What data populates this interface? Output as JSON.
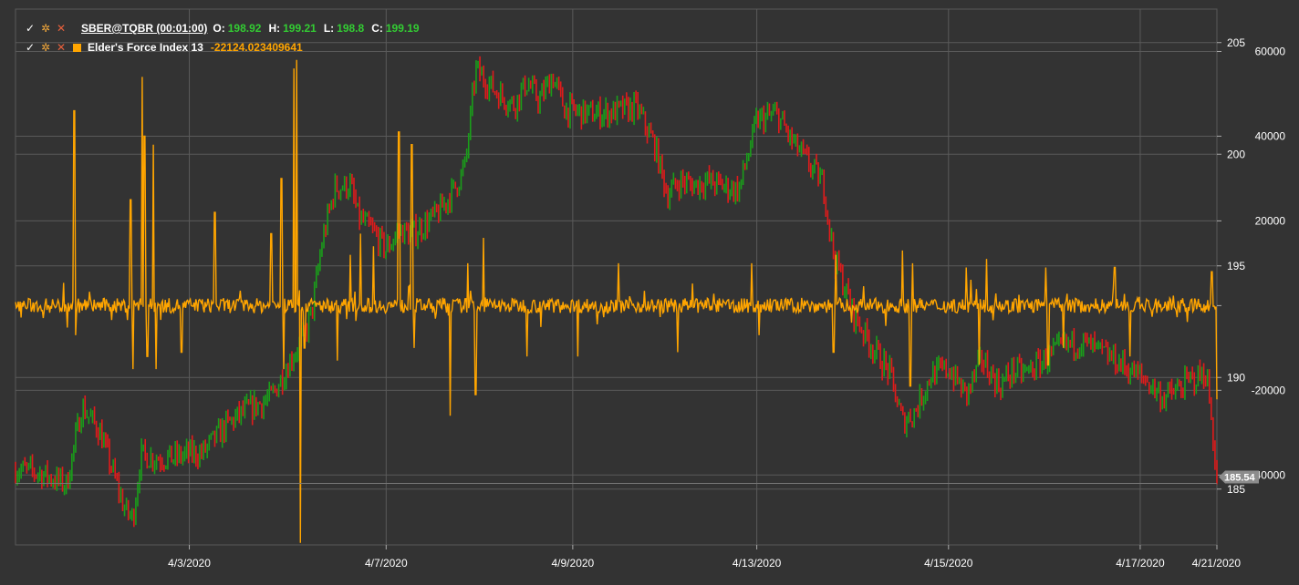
{
  "legend": {
    "symbol": "SBER@TQBR (00:01:00)",
    "o_label": "O:",
    "o": "198.92",
    "h_label": "H:",
    "h": "199.21",
    "l_label": "L:",
    "l": "198.8",
    "c_label": "C:",
    "c": "199.19",
    "indicator_name": "Elder's Force Index 13",
    "indicator_value": "-22124.023409641"
  },
  "icons": [
    "check-icon",
    "gear-icon",
    "close-icon",
    "color-square-icon"
  ],
  "colors": {
    "background": "#333333",
    "grid": "#5a5a5a",
    "up": "#1a9e1a",
    "down": "#e01b1b",
    "indicator": "#ffa500",
    "price_badge": "#8c8c8c"
  },
  "chart_data": {
    "type": "candlestick",
    "x_ticks": [
      "4/3/2020",
      "4/7/2020",
      "4/9/2020",
      "4/13/2020",
      "4/15/2020",
      "4/17/2020",
      "4/21/2020"
    ],
    "price_axis": {
      "ticks": [
        "205",
        "200",
        "195",
        "190",
        "185"
      ],
      "range": [
        182.5,
        206.5
      ]
    },
    "indicator_axis": {
      "ticks": [
        "60000",
        "40000",
        "20000",
        "",
        "-20000",
        "-40000"
      ],
      "range": [
        -56500,
        70000
      ]
    },
    "last_price": "185.54",
    "price_path": [
      [
        0.0,
        185.9
      ],
      [
        1.0,
        185.7
      ],
      [
        2.0,
        185.2
      ],
      [
        2.6,
        188.7
      ],
      [
        2.9,
        188.2
      ],
      [
        3.3,
        187.6
      ],
      [
        4.3,
        184.0
      ],
      [
        4.6,
        183.7
      ],
      [
        4.9,
        186.5
      ],
      [
        5.5,
        186.4
      ],
      [
        6.2,
        186.4
      ],
      [
        6.9,
        186.6
      ],
      [
        7.3,
        186.6
      ],
      [
        8.3,
        187.9
      ],
      [
        9.0,
        188.5
      ],
      [
        10.0,
        189.1
      ],
      [
        10.5,
        190.2
      ],
      [
        10.8,
        190.9
      ],
      [
        11.3,
        191.8
      ],
      [
        11.6,
        193.0
      ],
      [
        12.0,
        196.1
      ],
      [
        12.5,
        198.5
      ],
      [
        13.1,
        198.6
      ],
      [
        13.4,
        197.2
      ],
      [
        14.0,
        196.5
      ],
      [
        14.5,
        195.7
      ],
      [
        15.0,
        196.6
      ],
      [
        15.5,
        196.4
      ],
      [
        16.5,
        197.3
      ],
      [
        17.2,
        198.5
      ],
      [
        17.6,
        199.5
      ],
      [
        18.0,
        203.8
      ],
      [
        18.8,
        202.8
      ],
      [
        19.5,
        202.2
      ],
      [
        20.0,
        203.2
      ],
      [
        20.5,
        202.4
      ],
      [
        21.0,
        203.5
      ],
      [
        21.5,
        202.0
      ],
      [
        22.5,
        201.8
      ],
      [
        23.5,
        201.9
      ],
      [
        24.3,
        202.1
      ],
      [
        25.0,
        200.4
      ],
      [
        25.5,
        198.2
      ],
      [
        26.0,
        198.8
      ],
      [
        26.5,
        198.6
      ],
      [
        27.0,
        198.8
      ],
      [
        27.9,
        198.5
      ],
      [
        28.3,
        198.4
      ],
      [
        29.0,
        201.5
      ],
      [
        29.8,
        201.8
      ],
      [
        30.3,
        200.7
      ],
      [
        31.0,
        199.6
      ],
      [
        31.6,
        198.7
      ],
      [
        32.0,
        195.5
      ],
      [
        32.8,
        192.8
      ],
      [
        33.5,
        191.4
      ],
      [
        34.2,
        190.2
      ],
      [
        34.7,
        188.0
      ],
      [
        35.2,
        188.5
      ],
      [
        35.8,
        190.1
      ],
      [
        36.5,
        190.4
      ],
      [
        37.2,
        189.2
      ],
      [
        37.8,
        190.8
      ],
      [
        38.5,
        189.6
      ],
      [
        39.0,
        190.3
      ],
      [
        39.5,
        190.2
      ],
      [
        40.3,
        190.8
      ],
      [
        41.0,
        191.4
      ],
      [
        41.7,
        191.6
      ],
      [
        42.3,
        191.2
      ],
      [
        43.0,
        190.8
      ],
      [
        43.5,
        190.4
      ],
      [
        44.2,
        189.9
      ],
      [
        44.9,
        189.1
      ],
      [
        45.3,
        189.3
      ],
      [
        46.0,
        189.9
      ],
      [
        46.6,
        190.2
      ],
      [
        47.0,
        185.5
      ]
    ],
    "indicator_spikes": [
      [
        2.3,
        46000
      ],
      [
        2.35,
        -7000
      ],
      [
        4.5,
        25000
      ],
      [
        4.6,
        -15000
      ],
      [
        4.95,
        54000
      ],
      [
        5.05,
        40000
      ],
      [
        5.15,
        -12000
      ],
      [
        5.4,
        38000
      ],
      [
        5.5,
        -15000
      ],
      [
        6.5,
        -11000
      ],
      [
        7.8,
        22000
      ],
      [
        10.0,
        17000
      ],
      [
        10.4,
        30000
      ],
      [
        10.5,
        -15000
      ],
      [
        10.9,
        56000
      ],
      [
        11.0,
        58000
      ],
      [
        11.15,
        -56000
      ],
      [
        11.3,
        -10000
      ],
      [
        12.6,
        -13000
      ],
      [
        13.1,
        12000
      ],
      [
        13.5,
        17000
      ],
      [
        14.0,
        14000
      ],
      [
        15.0,
        41000
      ],
      [
        15.5,
        38000
      ],
      [
        15.6,
        -10000
      ],
      [
        17.0,
        -26000
      ],
      [
        17.7,
        10000
      ],
      [
        18.0,
        -21000
      ],
      [
        18.3,
        16000
      ],
      [
        20.0,
        -12000
      ],
      [
        22.0,
        -12000
      ],
      [
        23.6,
        10000
      ],
      [
        25.9,
        -11000
      ],
      [
        28.8,
        10000
      ],
      [
        29.1,
        -7000
      ],
      [
        32.0,
        -11000
      ],
      [
        32.1,
        12000
      ],
      [
        34.7,
        13000
      ],
      [
        35.0,
        -19000
      ],
      [
        35.1,
        10000
      ],
      [
        37.2,
        9000
      ],
      [
        37.7,
        -14000
      ],
      [
        38.0,
        11000
      ],
      [
        40.3,
        9000
      ],
      [
        40.4,
        -14000
      ],
      [
        41.0,
        -10000
      ],
      [
        43.0,
        9000
      ],
      [
        43.6,
        -12000
      ],
      [
        46.8,
        8000
      ],
      [
        47.0,
        -22124
      ]
    ]
  }
}
